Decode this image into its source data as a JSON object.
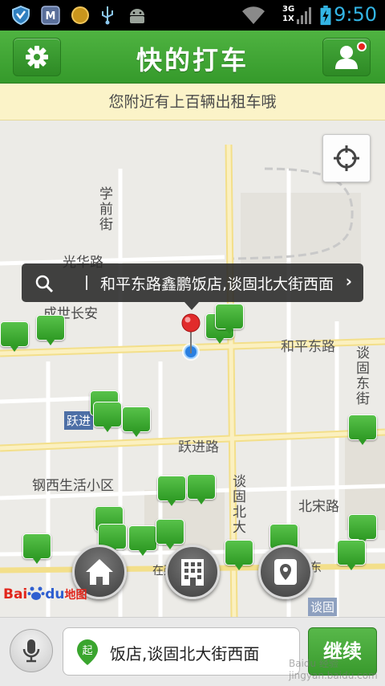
{
  "status_bar": {
    "time": "9:50",
    "network_top": "3G",
    "network_bottom": "1X",
    "icons": [
      "shield-icon",
      "m-app-icon",
      "coin-icon",
      "usb-icon",
      "android-icon",
      "wifi-icon",
      "signal-icon",
      "battery-charging-icon"
    ]
  },
  "header": {
    "title": "快的打车",
    "left_icon": "gear-icon",
    "right_icon": "user-icon",
    "has_notification": true
  },
  "banner": {
    "text": "您附近有上百辆出租车哦"
  },
  "map": {
    "labels": {
      "xueqianjie": "学前街",
      "guanghualu": "光华路",
      "chengshichangan": "成世长安",
      "hepingdonglu": "和平东路",
      "tangudongjie": "谈固东街",
      "yuejin_blue": "跃进",
      "yuejinlu": "跃进路",
      "gangxi": "钢西生活小区",
      "tangubeida": "谈固北大",
      "beisonglu": "北宋路",
      "zhongshandong": "中山东",
      "tangu_grey": "谈固",
      "zai_jian": "在建",
      "hexian": "河东"
    },
    "callout": {
      "address": "和平东路鑫鹏饭店,谈固北大街西面"
    },
    "logo_text": {
      "bai": "Bai",
      "du": "du",
      "ditu": "地图"
    },
    "colors": {
      "taxi_green": "#3aa52e",
      "road_yellow": "#f6e7a0",
      "header_green": "#3da332"
    }
  },
  "bottom_bar": {
    "start_badge": "起",
    "address_value": "饭店,谈固北大街西面",
    "continue_label": "继续",
    "watermark": "Baidu 经验 jingyan.baidu.com"
  }
}
